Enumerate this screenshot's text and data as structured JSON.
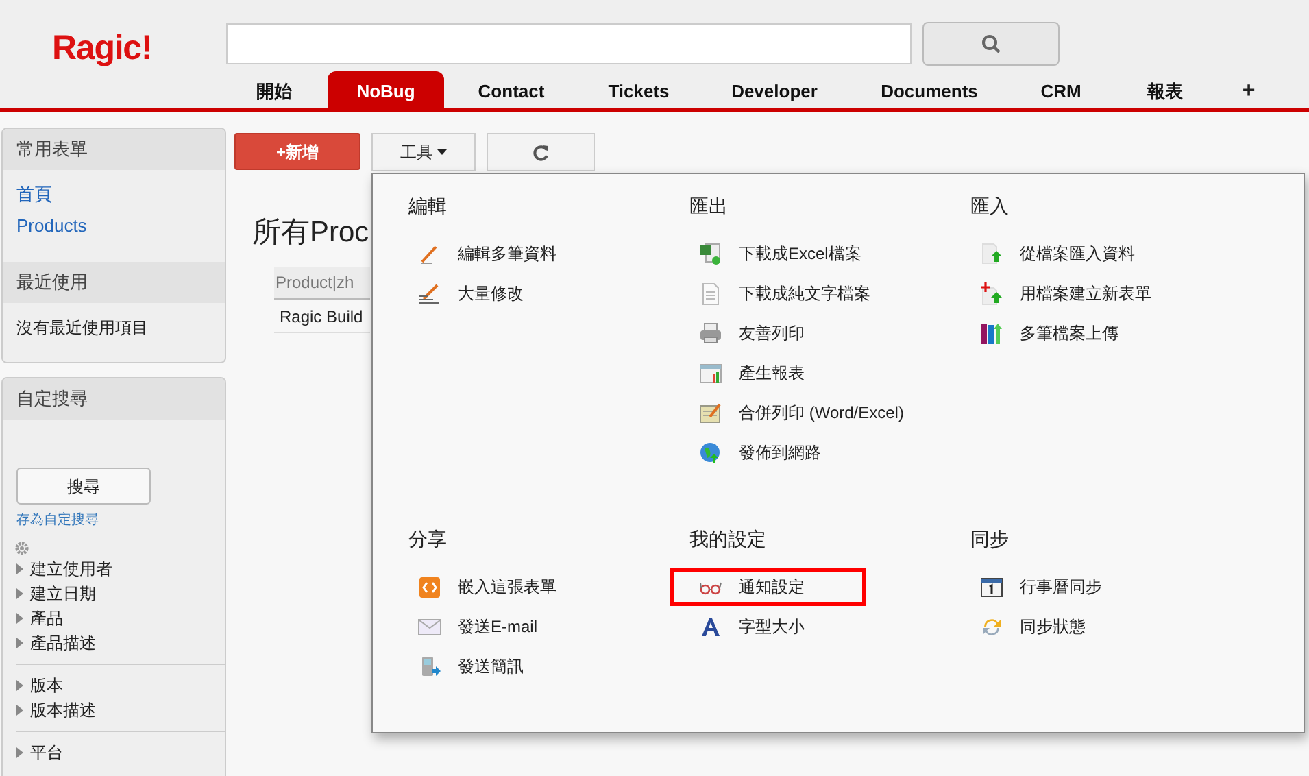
{
  "logo": "Ragic!",
  "tabs": [
    {
      "label": "開始",
      "selected": false
    },
    {
      "label": "NoBug",
      "selected": true
    },
    {
      "label": "Contact",
      "selected": false
    },
    {
      "label": "Tickets",
      "selected": false
    },
    {
      "label": "Developer",
      "selected": false
    },
    {
      "label": "Documents",
      "selected": false
    },
    {
      "label": "CRM",
      "selected": false
    },
    {
      "label": "報表",
      "selected": false
    }
  ],
  "add_tab": "+",
  "sidebar": {
    "favorites": {
      "title": "常用表單",
      "links": [
        "首頁",
        "Products"
      ]
    },
    "recent": {
      "title": "最近使用",
      "empty_text": "沒有最近使用項目"
    },
    "custom_search": {
      "title": "自定搜尋",
      "search_button": "搜尋",
      "save_link": "存為自定搜尋",
      "field_groups": [
        [
          "建立使用者",
          "建立日期",
          "產品",
          "產品描述"
        ],
        [
          "版本",
          "版本描述"
        ],
        [
          "平台"
        ]
      ]
    }
  },
  "toolbar": {
    "new_button": "+新增",
    "tools_button": "工具"
  },
  "content": {
    "title": "所有Proc",
    "column_1": "Product|zh",
    "rows": [
      "Ragic Build"
    ]
  },
  "tools_menu": {
    "sections": [
      {
        "title": "編輯",
        "items": [
          {
            "label": "編輯多筆資料",
            "highlighted": false
          },
          {
            "label": "大量修改",
            "highlighted": false
          }
        ]
      },
      {
        "title": "匯出",
        "items": [
          {
            "label": "下載成Excel檔案",
            "highlighted": false
          },
          {
            "label": "下載成純文字檔案",
            "highlighted": false
          },
          {
            "label": "友善列印",
            "highlighted": false
          },
          {
            "label": "產生報表",
            "highlighted": false
          },
          {
            "label": "合併列印 (Word/Excel)",
            "highlighted": false
          },
          {
            "label": "發佈到網路",
            "highlighted": false
          }
        ]
      },
      {
        "title": "匯入",
        "items": [
          {
            "label": "從檔案匯入資料",
            "highlighted": false
          },
          {
            "label": "用檔案建立新表單",
            "highlighted": false
          },
          {
            "label": "多筆檔案上傳",
            "highlighted": false
          }
        ]
      },
      {
        "title": "分享",
        "items": [
          {
            "label": "嵌入這張表單",
            "highlighted": false
          },
          {
            "label": "發送E-mail",
            "highlighted": false
          },
          {
            "label": "發送簡訊",
            "highlighted": false
          }
        ]
      },
      {
        "title": "我的設定",
        "items": [
          {
            "label": "通知設定",
            "highlighted": true
          },
          {
            "label": "字型大小",
            "highlighted": false
          }
        ]
      },
      {
        "title": "同步",
        "items": [
          {
            "label": "行事曆同步",
            "highlighted": false
          },
          {
            "label": "同步狀態",
            "highlighted": false
          }
        ]
      }
    ]
  }
}
